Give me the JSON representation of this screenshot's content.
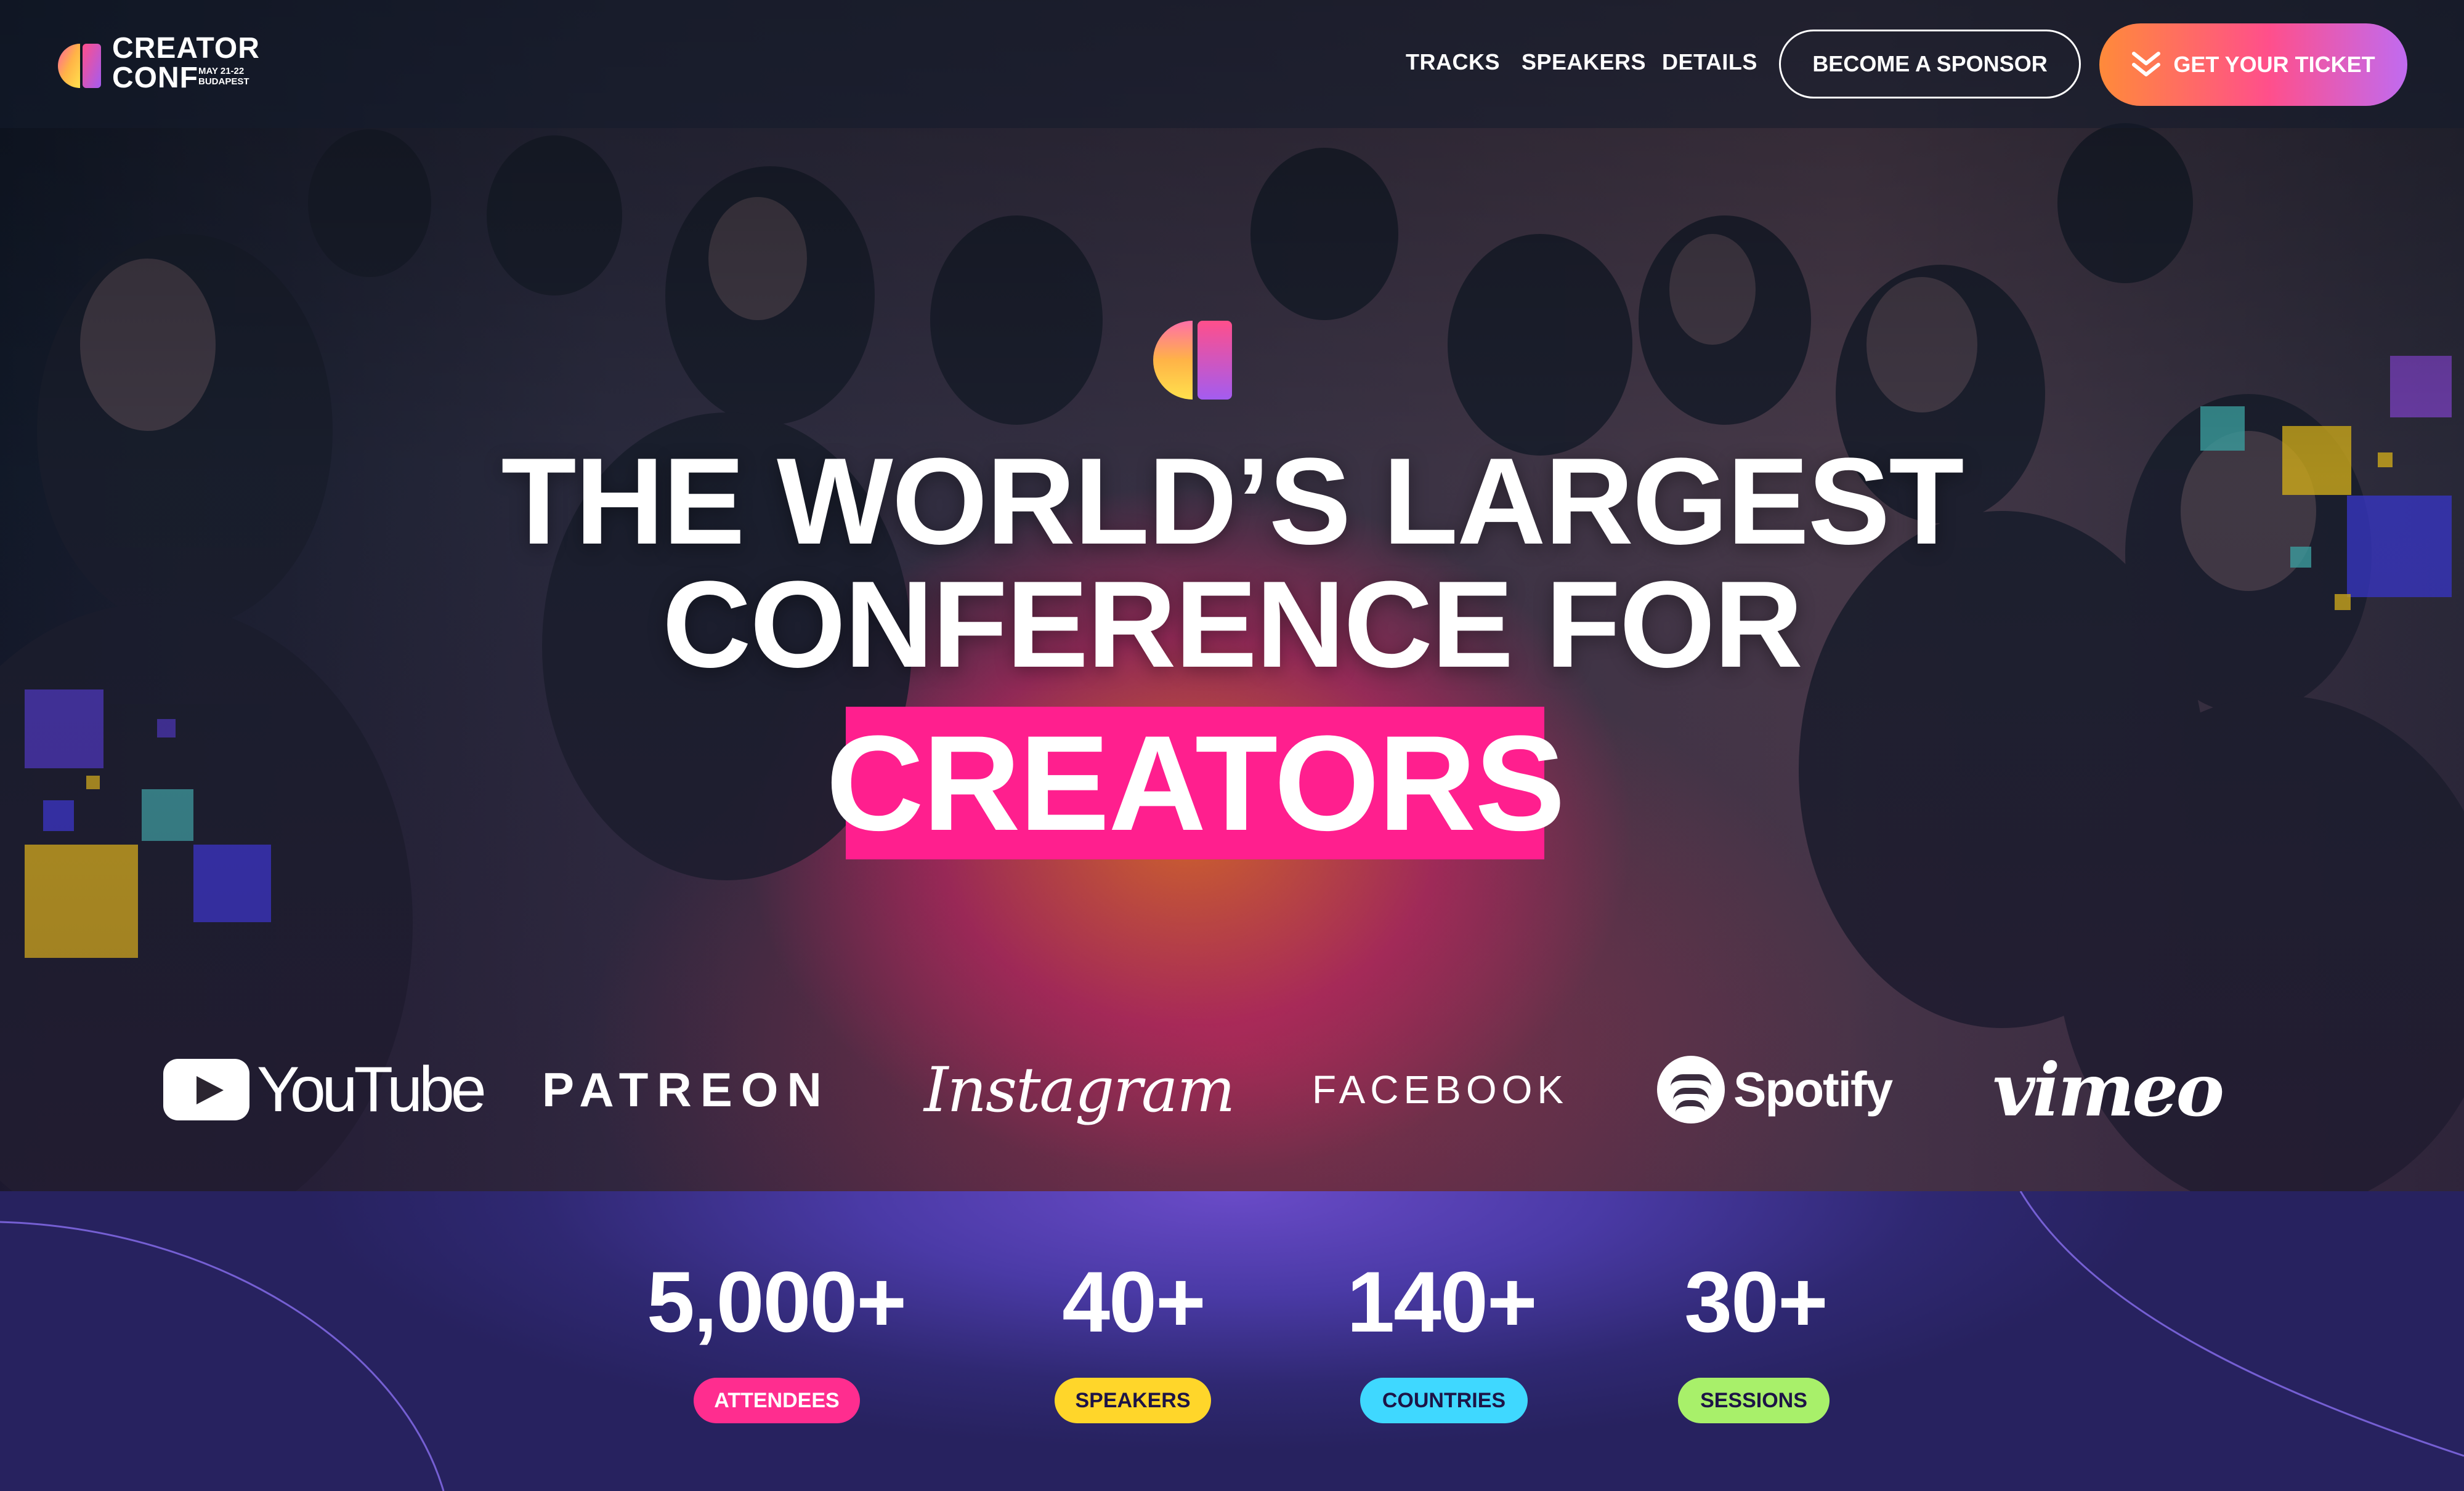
{
  "brand": {
    "logo_line1": "CREATOR",
    "logo_line2": "CONF",
    "logo_dates": "MAY 21-22",
    "logo_city": "BUDAPEST"
  },
  "nav": {
    "links": [
      "TRACKS",
      "SPEAKERS",
      "DETAILS"
    ],
    "sponsor_button": "BECOME A SPONSOR",
    "ticket_button": "GET YOUR TICKET"
  },
  "hero": {
    "headline_line1": "THE WORLD’S LARGEST",
    "headline_line2": "CONFERENCE FOR",
    "headline_highlight": "CREATORS",
    "highlight_color": "#ff1f8e"
  },
  "partners": {
    "youtube": "YouTube",
    "patreon": "PATREON",
    "instagram": "Instagram",
    "facebook": "FACEBOOK",
    "spotify": "Spotify",
    "vimeo": "vimeo"
  },
  "stats": [
    {
      "value": "5,000+",
      "label": "ATTENDEES",
      "color": "#ff2d8f"
    },
    {
      "value": "40+",
      "label": "SPEAKERS",
      "color": "#ffd62a"
    },
    {
      "value": "140+",
      "label": "COUNTRIES",
      "color": "#3fd8ff"
    },
    {
      "value": "30+",
      "label": "SESSIONS",
      "color": "#a8f06a"
    }
  ]
}
